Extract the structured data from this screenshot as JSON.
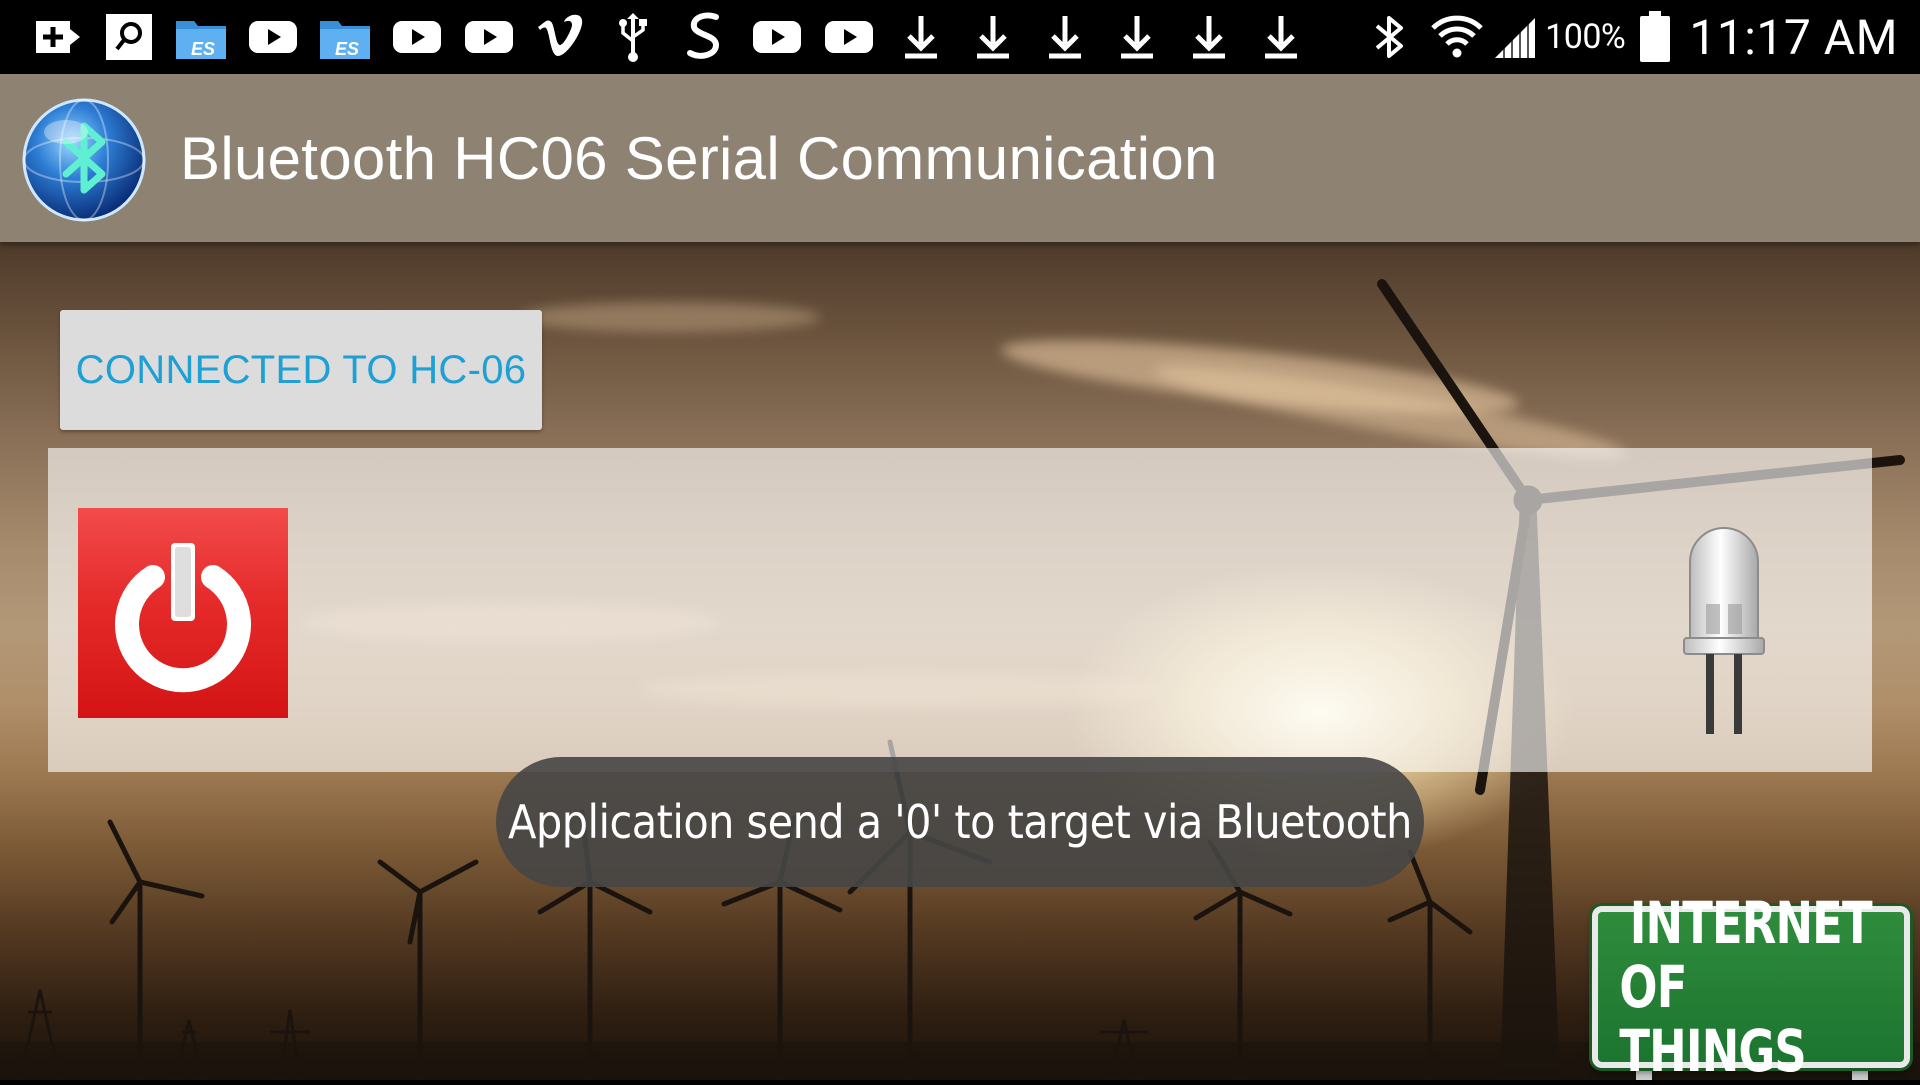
{
  "status_bar": {
    "notification_icons": [
      "add-box-icon",
      "search-box-icon",
      "es-file-explorer-icon",
      "youtube-icon",
      "es-file-explorer-icon",
      "youtube-icon",
      "youtube-icon",
      "vimeo-icon",
      "usb-icon",
      "swiftkey-icon",
      "youtube-icon",
      "youtube-icon",
      "download-icon",
      "download-icon",
      "download-icon",
      "download-icon",
      "download-icon",
      "download-icon"
    ],
    "system_icons": [
      "bluetooth-icon",
      "wifi-icon",
      "signal-icon",
      "battery-icon"
    ],
    "battery_percent": "100%",
    "time": "11:17 AM"
  },
  "action_bar": {
    "app_icon": "bluetooth-globe-icon",
    "title": "Bluetooth HC06 Serial Communication"
  },
  "connection": {
    "button_label": "CONNECTED TO HC-06"
  },
  "control_panel": {
    "power_button_icon": "power-icon",
    "led_icon": "led-bulb-icon"
  },
  "toast": {
    "message": "Application send a '0' to target via Bluetooth"
  },
  "iot_sign": {
    "line1": "INTERNET",
    "line2": "OF THINGS"
  },
  "colors": {
    "action_bar": "#8e8272",
    "connect_text": "#1ea0d4",
    "power_red": "#e52a2a",
    "sign_green": "#1f7a33"
  }
}
